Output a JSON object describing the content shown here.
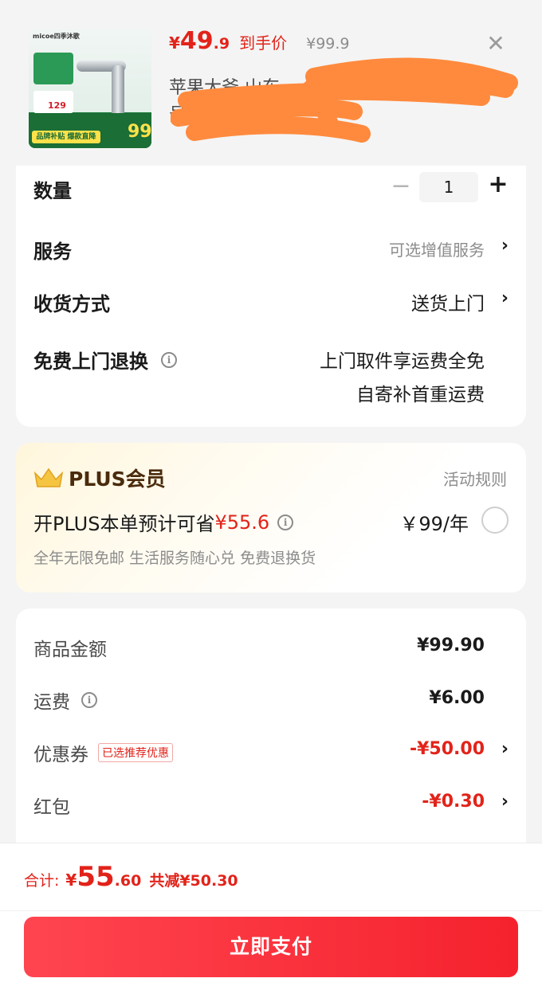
{
  "product": {
    "thumb_brand": "micoe四季沐歌",
    "thumb_tag_price": "129",
    "thumb_big_price": "99",
    "thumb_strip_label": "品牌补贴 爆款直降",
    "price_yen": "¥",
    "price_int": "49",
    "price_dec": ".9",
    "price_label": "到手价",
    "price_old": "¥99.9",
    "address_line1": "苹果大爷  山东",
    "address_line2": "号",
    "address_arrow": "›"
  },
  "options": {
    "quantity_label": "数量",
    "quantity_value": "1",
    "service_label": "服务",
    "service_value": "可选增值服务",
    "delivery_label": "收货方式",
    "delivery_value": "送货上门",
    "return_label": "免费上门退换",
    "return_value_line1": "上门取件享运费全免",
    "return_value_line2": "自寄补首重运费"
  },
  "plus": {
    "title": "PLUS会员",
    "rules": "活动规则",
    "save_prefix": "开PLUS本单预计可省",
    "save_amount": "¥55.6",
    "price": "￥99/年",
    "benefits": "全年无限免邮  生活服务随心兑  免费退换货"
  },
  "summary": {
    "goods_label": "商品金额",
    "goods_value": "¥99.90",
    "shipping_label": "运费",
    "shipping_value": "¥6.00",
    "coupon_label": "优惠券",
    "coupon_badge": "已选推荐优惠",
    "coupon_value": "-¥50.00",
    "redpacket_label": "红包",
    "redpacket_value": "-¥0.30"
  },
  "footer": {
    "total_label": "合计:",
    "total_yen": "¥",
    "total_int": "55",
    "total_dec": ".60",
    "total_reduce": "共减¥50.30",
    "pay_button": "立即支付"
  },
  "colors": {
    "accent_red": "#e2231a",
    "pay_button": "#f5222d",
    "plus_brown": "#4a2b0c",
    "crown_gold": "#f5c542",
    "redaction_orange": "#ff8a3d"
  },
  "icons": {
    "close": "close-icon",
    "chevron": "chevron-right-icon",
    "info": "info-icon",
    "crown": "crown-icon"
  }
}
